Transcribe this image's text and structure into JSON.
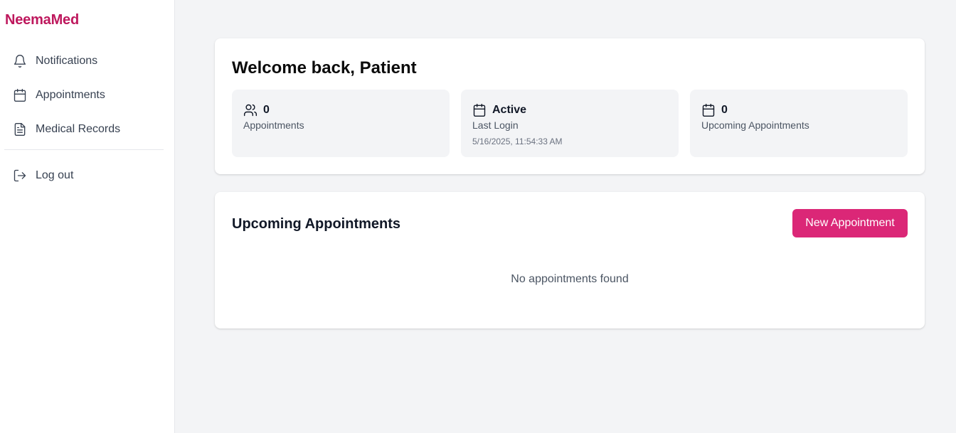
{
  "brand": {
    "name": "NeemaMed",
    "color": "#be185d"
  },
  "sidebar": {
    "items": [
      {
        "label": "Notifications",
        "icon": "bell-icon"
      },
      {
        "label": "Appointments",
        "icon": "calendar-icon"
      },
      {
        "label": "Medical Records",
        "icon": "document-icon"
      }
    ],
    "logout": {
      "label": "Log out",
      "icon": "logout-icon"
    }
  },
  "welcome": {
    "title": "Welcome back, Patient",
    "stats": [
      {
        "value": "0",
        "label": "Appointments",
        "icon": "users-icon"
      },
      {
        "value": "Active",
        "label": "Last Login",
        "sub": "5/16/2025, 11:54:33 AM",
        "icon": "calendar-icon"
      },
      {
        "value": "0",
        "label": "Upcoming Appointments",
        "icon": "calendar-icon"
      }
    ]
  },
  "appointments": {
    "title": "Upcoming Appointments",
    "new_button": "New Appointment",
    "empty_message": "No appointments found",
    "accent_color": "#db2777"
  }
}
